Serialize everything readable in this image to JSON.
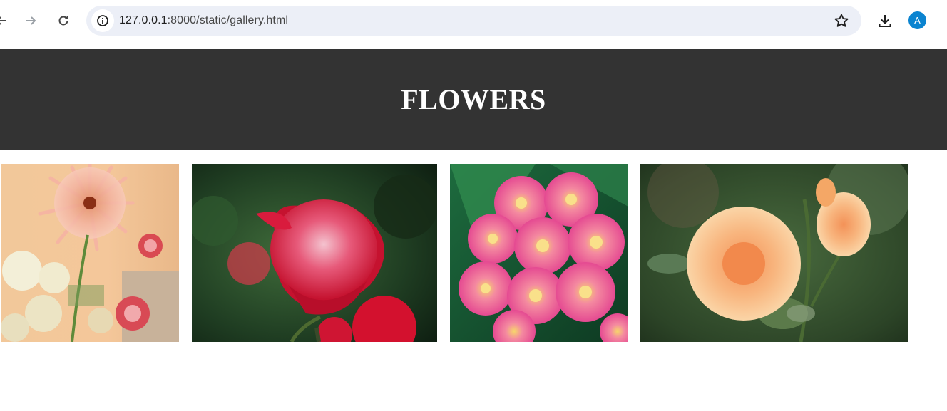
{
  "browser": {
    "url_host": "127.0.0.1",
    "url_path": ":8000/static/gallery.html",
    "avatar_initial": "A",
    "icons": [
      "back-arrow-icon",
      "forward-arrow-icon",
      "reload-icon",
      "info-icon",
      "star-icon",
      "download-icon"
    ]
  },
  "header": {
    "title": "FLOWERS",
    "background_color": "#333333"
  },
  "gallery": {
    "images": [
      {
        "subject": "gerbera-and-carnation-bouquet"
      },
      {
        "subject": "red-rose"
      },
      {
        "subject": "pink-plumeria"
      },
      {
        "subject": "peach-roses"
      }
    ]
  }
}
